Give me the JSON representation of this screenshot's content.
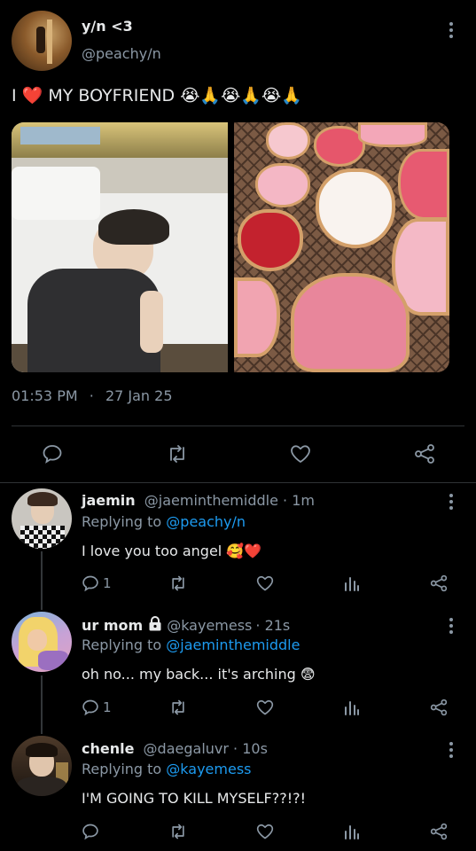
{
  "main_tweet": {
    "display_name": "y/n <3",
    "handle": "@peachy/n",
    "text": "I ❤️ MY BOYFRIEND 😭🙏😭🙏😭🙏",
    "time": "01:53 PM",
    "date": "27 Jan 25",
    "separator": "·",
    "images": [
      {
        "name": "man-on-bed-photo"
      },
      {
        "name": "heart-cookies-photo"
      }
    ]
  },
  "replies": [
    {
      "display_name": "jaemin",
      "handle": "@jaeminthemiddle",
      "time": "· 1m",
      "replying_prefix": "Replying to",
      "replying_to": "@peachy/n",
      "text": "I love you too angel 🥰❤️",
      "reply_count": "1",
      "locked": false
    },
    {
      "display_name": "ur mom",
      "handle": "@kayemess",
      "time": "· 21s",
      "replying_prefix": "Replying to",
      "replying_to": "@jaeminthemiddle",
      "text": "oh no... my back... it's arching 😨",
      "reply_count": "1",
      "locked": true
    },
    {
      "display_name": "chenle",
      "handle": "@daegaluvr",
      "time": "· 10s",
      "replying_prefix": "Replying to",
      "replying_to": "@kayemess",
      "text": "I'M GOING TO KILL MYSELF??!?!",
      "reply_count": "",
      "locked": false
    }
  ],
  "colors": {
    "background": "#000000",
    "text": "#e7e9ea",
    "muted": "#8b98a5",
    "link": "#1d9bf0",
    "divider": "#2f3336"
  },
  "icons": [
    "reply-icon",
    "retweet-icon",
    "like-icon",
    "share-icon",
    "views-icon",
    "more-icon",
    "lock-icon"
  ]
}
